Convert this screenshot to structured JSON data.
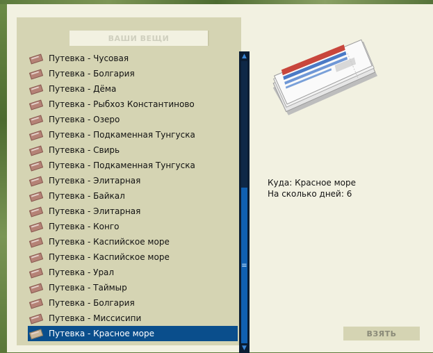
{
  "panel": {
    "title": "ВАШИ ВЕЩИ"
  },
  "items": [
    "Путевка - Чусовая",
    "Путевка - Болгария",
    "Путевка - Дёма",
    "Путевка - Рыбхоз Константиново",
    "Путевка - Озеро",
    "Путевка - Подкаменная Тунгуска",
    "Путевка - Свирь",
    "Путевка - Подкаменная Тунгуска",
    "Путевка - Элитарная",
    "Путевка - Байкал",
    "Путевка - Элитарная",
    "Путевка - Конго",
    "Путевка - Каспийское море",
    "Путевка - Каспийское море",
    "Путевка - Урал",
    "Путевка - Таймыр",
    "Путевка - Болгария",
    "Путевка - Миссисипи",
    "Путевка - Красное море"
  ],
  "selected_index": 18,
  "details": {
    "destination_label": "Куда:",
    "destination_value": "Красное море",
    "days_label": "На сколько дней:",
    "days_value": "6"
  },
  "actions": {
    "take_label": "ВЗЯТЬ"
  },
  "icons": {
    "item_icon": "ticket-icon",
    "preview": "ticket-bundle-image"
  },
  "colors": {
    "selection": "#0a4e8c",
    "scroll_thumb": "#1060b2",
    "panel_bg": "#f2f1e1"
  }
}
